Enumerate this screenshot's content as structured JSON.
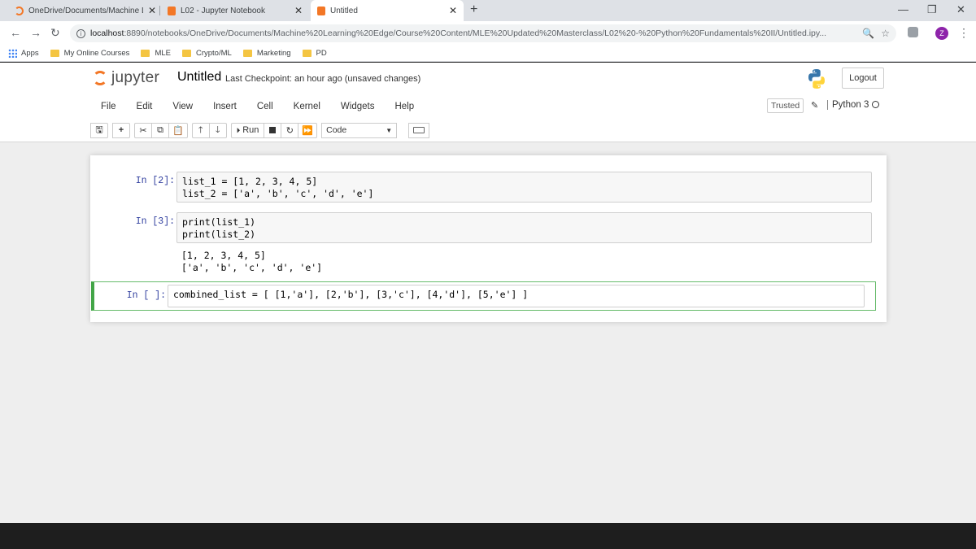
{
  "browser": {
    "tabs": [
      {
        "title": "OneDrive/Documents/Machine L",
        "color": "#f37726"
      },
      {
        "title": "L02 - Jupyter Notebook",
        "color": "#f37726"
      },
      {
        "title": "Untitled",
        "color": "#f37726"
      }
    ],
    "url_host": "localhost",
    "url_path": ":8890/notebooks/OneDrive/Documents/Machine%20Learning%20Edge/Course%20Content/MLE%20Updated%20Masterclass/L02%20-%20Python%20Fundamentals%20II/Untitled.ipy...",
    "avatar_letter": "Z",
    "bookmarks": [
      "Apps",
      "My Online Courses",
      "MLE",
      "Crypto/ML",
      "Marketing",
      "PD"
    ]
  },
  "jupyter": {
    "logo_text": "jupyter",
    "notebook_name": "Untitled",
    "checkpoint": "Last Checkpoint: an hour ago  (unsaved changes)",
    "logout_label": "Logout",
    "menu": [
      "File",
      "Edit",
      "View",
      "Insert",
      "Cell",
      "Kernel",
      "Widgets",
      "Help"
    ],
    "trusted_label": "Trusted",
    "kernel_name": "Python 3",
    "run_label": "Run",
    "cell_type": "Code"
  },
  "cells": [
    {
      "prompt": "In [2]:",
      "lines": [
        "list_1 = [1, 2, 3, 4, 5]",
        "list_2 = ['a', 'b', 'c', 'd', 'e']"
      ]
    },
    {
      "prompt": "In [3]:",
      "lines": [
        "print(list_1)",
        "print(list_2)"
      ],
      "output": [
        "[1, 2, 3, 4, 5]",
        "['a', 'b', 'c', 'd', 'e']"
      ]
    },
    {
      "prompt": "In [ ]:",
      "lines": [
        "combined_list = [ [1,'a'], [2,'b'], [3,'c'], [4,'d'], [5,'e'] ]"
      ]
    }
  ],
  "colors": {
    "prompt": "#303f9f",
    "selected_border": "#42a547",
    "jupyter_orange": "#f37726"
  }
}
